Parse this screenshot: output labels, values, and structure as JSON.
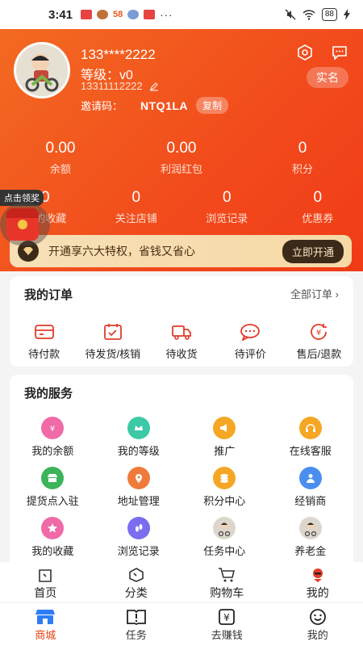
{
  "status_bar": {
    "time": "3:41",
    "app_badge": "58",
    "battery": "88",
    "dots": "···"
  },
  "profile": {
    "username": "133****2222",
    "level_text": "等级：v0",
    "phone": "13311112222",
    "invite_label": "邀请码：",
    "invite_code": "NTQ1LA",
    "copy_label": "复制",
    "realname_label": "实名"
  },
  "stats_row1": [
    {
      "value": "0.00",
      "label": "余额"
    },
    {
      "value": "0.00",
      "label": "利润红包"
    },
    {
      "value": "0",
      "label": "积分"
    }
  ],
  "stats_row2": [
    {
      "value": "0",
      "label": "我的收藏"
    },
    {
      "value": "0",
      "label": "关注店铺"
    },
    {
      "value": "0",
      "label": "浏览记录"
    },
    {
      "value": "0",
      "label": "优惠券"
    }
  ],
  "floating": {
    "tag": "点击领奖"
  },
  "vip": {
    "text": "开通享六大特权，省钱又省心",
    "button": "立即开通"
  },
  "orders": {
    "title": "我的订单",
    "all_label": "全部订单",
    "items": [
      {
        "label": "待付款",
        "icon": "wallet-icon"
      },
      {
        "label": "待发货/核销",
        "icon": "calendar-check-icon"
      },
      {
        "label": "待收货",
        "icon": "truck-icon"
      },
      {
        "label": "待评价",
        "icon": "chat-bubble-icon"
      },
      {
        "label": "售后/退款",
        "icon": "refund-icon"
      }
    ]
  },
  "services": {
    "title": "我的服务",
    "rows": [
      [
        {
          "label": "我的余额",
          "icon": "money-bag-icon",
          "color": "#f06aa8"
        },
        {
          "label": "我的等级",
          "icon": "level-crown-icon",
          "color": "#3cc9a6"
        },
        {
          "label": "推广",
          "icon": "megaphone-icon",
          "color": "#f5a623"
        },
        {
          "label": "在线客服",
          "icon": "headset-icon",
          "color": "#f5a623"
        }
      ],
      [
        {
          "label": "提货点入驻",
          "icon": "store-icon",
          "color": "#3cb45a"
        },
        {
          "label": "地址管理",
          "icon": "location-pin-icon",
          "color": "#f07a3a"
        },
        {
          "label": "积分中心",
          "icon": "coins-icon",
          "color": "#f5a623"
        },
        {
          "label": "经销商",
          "icon": "person-icon",
          "color": "#4a8ef0"
        }
      ],
      [
        {
          "label": "我的收藏",
          "icon": "star-icon",
          "color": "#f06aa8"
        },
        {
          "label": "浏览记录",
          "icon": "footprint-icon",
          "color": "#7c6cf0"
        },
        {
          "label": "任务中心",
          "icon": "avatar-image-icon",
          "color": "#9aa5b5"
        },
        {
          "label": "养老金",
          "icon": "avatar-image-icon",
          "color": "#9aa5b5"
        }
      ]
    ]
  },
  "top_nav": [
    {
      "label": "首页",
      "icon": "home-icon"
    },
    {
      "label": "分类",
      "icon": "category-icon"
    },
    {
      "label": "购物车",
      "icon": "cart-icon"
    },
    {
      "label": "我的",
      "icon": "profile-red-icon"
    }
  ],
  "bottom_nav": [
    {
      "label": "商城",
      "icon": "shop-icon",
      "active": true
    },
    {
      "label": "任务",
      "icon": "book-icon"
    },
    {
      "label": "去赚钱",
      "icon": "yen-icon"
    },
    {
      "label": "我的",
      "icon": "smile-icon"
    }
  ],
  "colors": {
    "brand": "#f24a1c",
    "accent_red": "#e8400f",
    "vip_gold": "#f7e0b7"
  }
}
